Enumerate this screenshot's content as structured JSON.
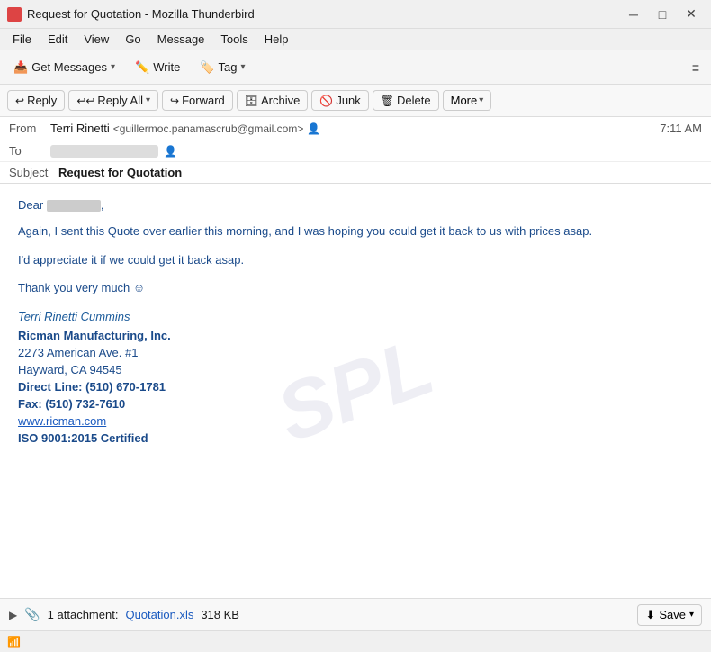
{
  "titlebar": {
    "title": "Request for Quotation - Mozilla Thunderbird",
    "icon": "🦅"
  },
  "menubar": {
    "items": [
      "File",
      "Edit",
      "View",
      "Go",
      "Message",
      "Tools",
      "Help"
    ]
  },
  "toolbar": {
    "get_messages": "Get Messages",
    "write": "Write",
    "tag": "Tag",
    "menu_icon": "≡"
  },
  "email_actions": {
    "reply": "Reply",
    "reply_all": "Reply All",
    "forward": "Forward",
    "archive": "Archive",
    "junk": "Junk",
    "delete": "Delete",
    "more": "More"
  },
  "email_header": {
    "from_label": "From",
    "from_name": "Terri Rinetti",
    "from_email": "<guillermoc.panamascrub@gmail.com>",
    "to_label": "To",
    "timestamp": "7:11 AM",
    "subject_label": "Subject",
    "subject": "Request for Quotation"
  },
  "email_body": {
    "greeting": "Dear",
    "para1": "Again, I sent this Quote over earlier this morning, and I was hoping you could get it back to us with prices asap.",
    "para2": "I'd appreciate it if we could get it back asap.",
    "thank_you": "Thank you very much ☺",
    "sig_name": "Terri Rinetti Cummins",
    "sig_company": "Ricman Manufacturing, Inc.",
    "sig_address1": "2273 American Ave. #1",
    "sig_address2": "Hayward, CA 94545",
    "sig_direct": "Direct Line: (510) 670-1781",
    "sig_fax": "Fax: (510) 732-7610",
    "sig_website": "www.ricman.com",
    "sig_cert": "ISO 9001:2015 Certified"
  },
  "attachment": {
    "count": "1 attachment:",
    "filename": "Quotation.xls",
    "size": "318 KB",
    "save_label": "Save",
    "download_icon": "⬇"
  },
  "status": {
    "icon": "📶"
  }
}
